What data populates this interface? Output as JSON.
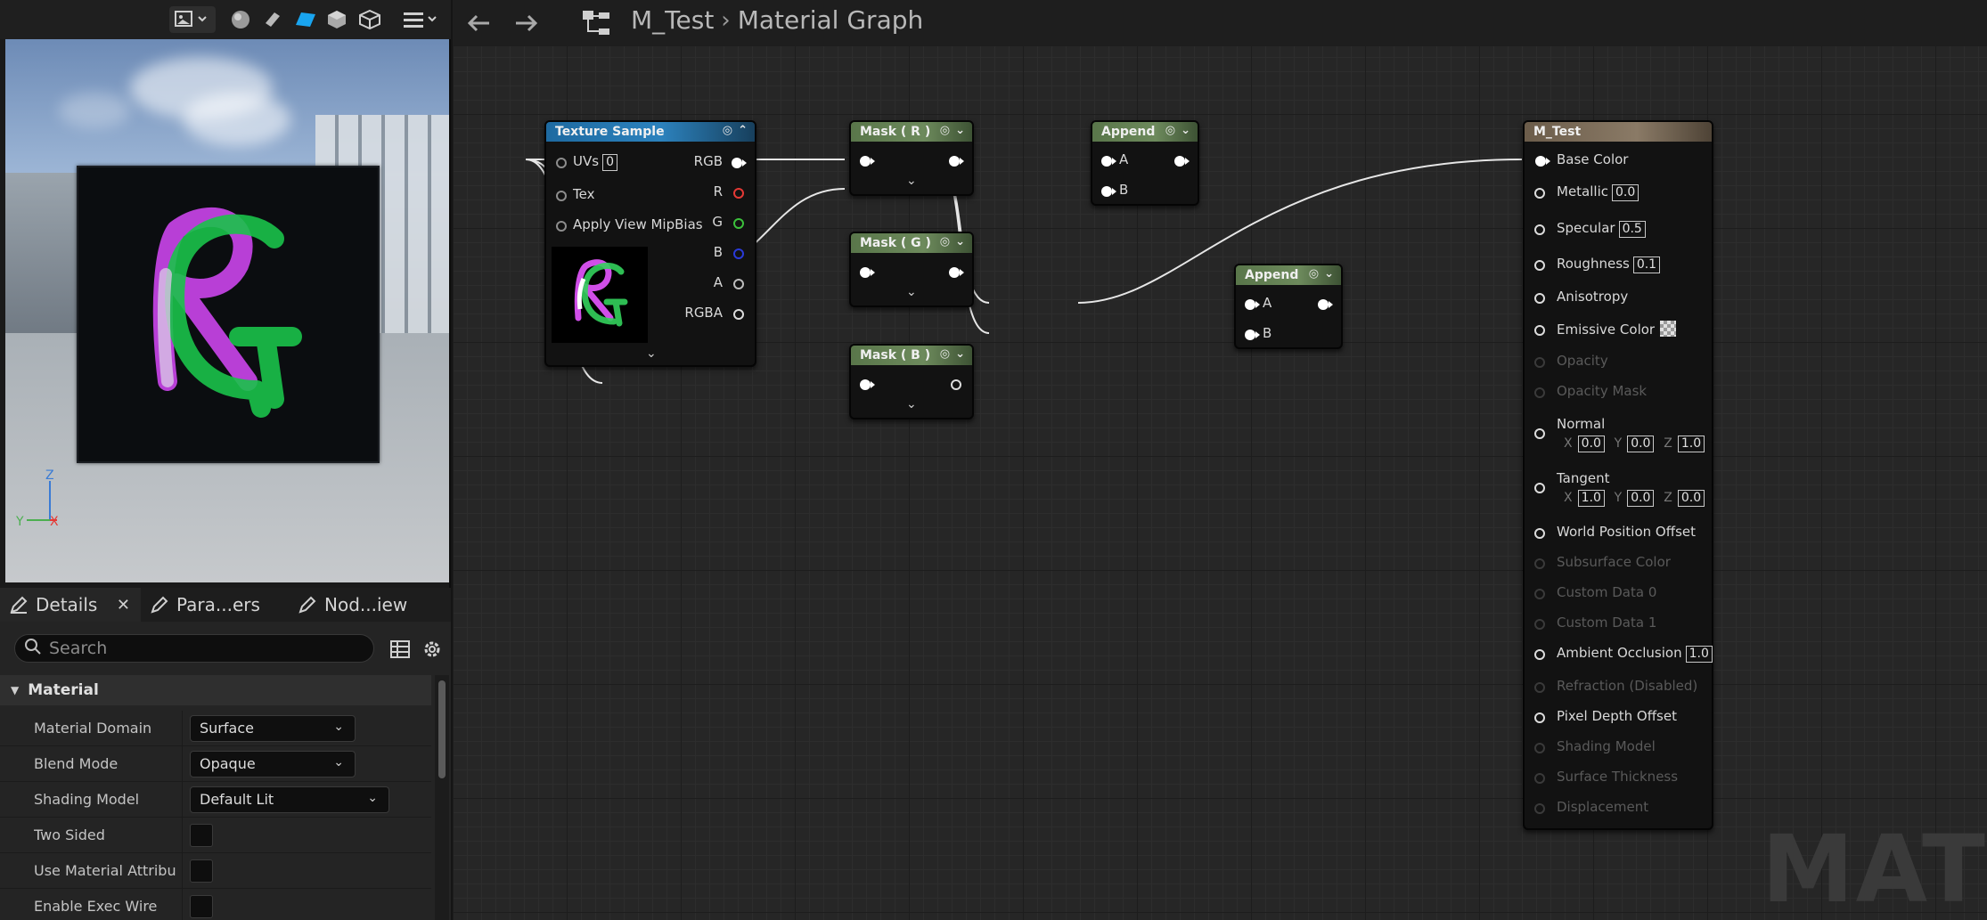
{
  "toolbar": {
    "icons": [
      "viewport-options-icon",
      "sphere-preview-icon",
      "cylinder-preview-icon",
      "plane-preview-icon",
      "cube-preview-icon",
      "custom-mesh-icon",
      "menu-icon"
    ]
  },
  "viewport": {
    "gizmo": {
      "z": "Z",
      "y": "Y",
      "x": "X"
    }
  },
  "tabs": [
    {
      "label": "Details",
      "close": "✕"
    },
    {
      "label": "Para...ers"
    },
    {
      "label": "Nod...iew"
    }
  ],
  "details": {
    "search_placeholder": "Search",
    "category": "Material",
    "properties": [
      {
        "name": "Material Domain",
        "value": "Surface"
      },
      {
        "name": "Blend Mode",
        "value": "Opaque"
      },
      {
        "name": "Shading Model",
        "value": "Default Lit"
      },
      {
        "name": "Two Sided",
        "checked": false
      },
      {
        "name": "Use Material Attribu...",
        "checked": false
      },
      {
        "name": "Enable Exec Wire",
        "checked": false
      }
    ]
  },
  "graph": {
    "breadcrumb": {
      "asset": "M_Test",
      "separator": "›",
      "page": "Material Graph"
    },
    "watermark": "MAT",
    "nodes": {
      "texture_sample": {
        "title": "Texture Sample",
        "inputs": {
          "uvs": "UVs",
          "uvs_value": "0",
          "tex": "Tex",
          "mip": "Apply View MipBias"
        },
        "outputs": {
          "rgb": "RGB",
          "r": "R",
          "g": "G",
          "b": "B",
          "a": "A",
          "rgba": "RGBA"
        }
      },
      "mask_r": {
        "title": "Mask ( R )"
      },
      "mask_g": {
        "title": "Mask ( G )"
      },
      "mask_b": {
        "title": "Mask ( B )"
      },
      "append_1": {
        "title": "Append",
        "a": "A",
        "b": "B"
      },
      "append_2": {
        "title": "Append",
        "a": "A",
        "b": "B"
      },
      "material": {
        "title": "M_Test",
        "pins": {
          "base_color": "Base Color",
          "metallic": "Metallic",
          "metallic_value": "0.0",
          "specular": "Specular",
          "specular_value": "0.5",
          "roughness": "Roughness",
          "roughness_value": "0.1",
          "anisotropy": "Anisotropy",
          "emissive": "Emissive Color",
          "opacity": "Opacity",
          "opacity_mask": "Opacity Mask",
          "normal": "Normal",
          "normal_x": "0.0",
          "normal_y": "0.0",
          "normal_z": "1.0",
          "tangent": "Tangent",
          "tangent_x": "1.0",
          "tangent_y": "0.0",
          "tangent_z": "0.0",
          "wpo": "World Position Offset",
          "subsurface": "Subsurface Color",
          "custom0": "Custom Data 0",
          "custom1": "Custom Data 1",
          "ao": "Ambient Occlusion",
          "ao_value": "1.0",
          "refraction": "Refraction (Disabled)",
          "pdo": "Pixel Depth Offset",
          "shading_model": "Shading Model",
          "surface_thickness": "Surface Thickness",
          "displacement": "Displacement"
        }
      }
    },
    "axis_labels": {
      "x": "X",
      "y": "Y",
      "z": "Z"
    }
  }
}
